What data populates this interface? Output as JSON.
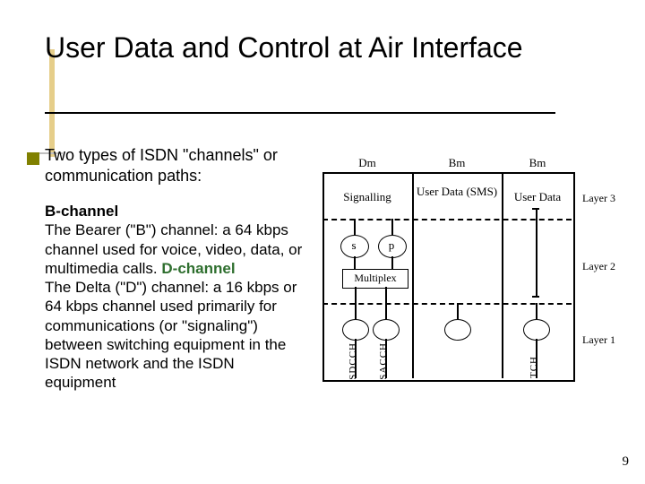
{
  "title": "User Data and Control at Air Interface",
  "intro": "Two types of ISDN \"channels\" or communication paths:",
  "body": {
    "b_heading": "B-channel",
    "b_text": "The Bearer (\"B\") channel: a 64 kbps channel used for voice, video, data, or multimedia calls. ",
    "d_heading": "D-channel",
    "d_text": "The Delta (\"D\") channel: a 16 kbps or 64 kbps channel used primarily for communications (or \"signaling\") between switching equipment in the ISDN network and the ISDN equipment"
  },
  "diagram": {
    "cols": [
      "Dm",
      "Bm",
      "Bm"
    ],
    "row1": [
      "Signalling",
      "User Data (SMS)",
      "User Data"
    ],
    "row2": {
      "s": "s",
      "p": "p",
      "multiplex": "Multiplex"
    },
    "layers": [
      "Layer 3",
      "Layer 2",
      "Layer 1"
    ],
    "bottom": [
      "SDCCH",
      "SACCH",
      "TCH"
    ]
  },
  "page_number": "9"
}
